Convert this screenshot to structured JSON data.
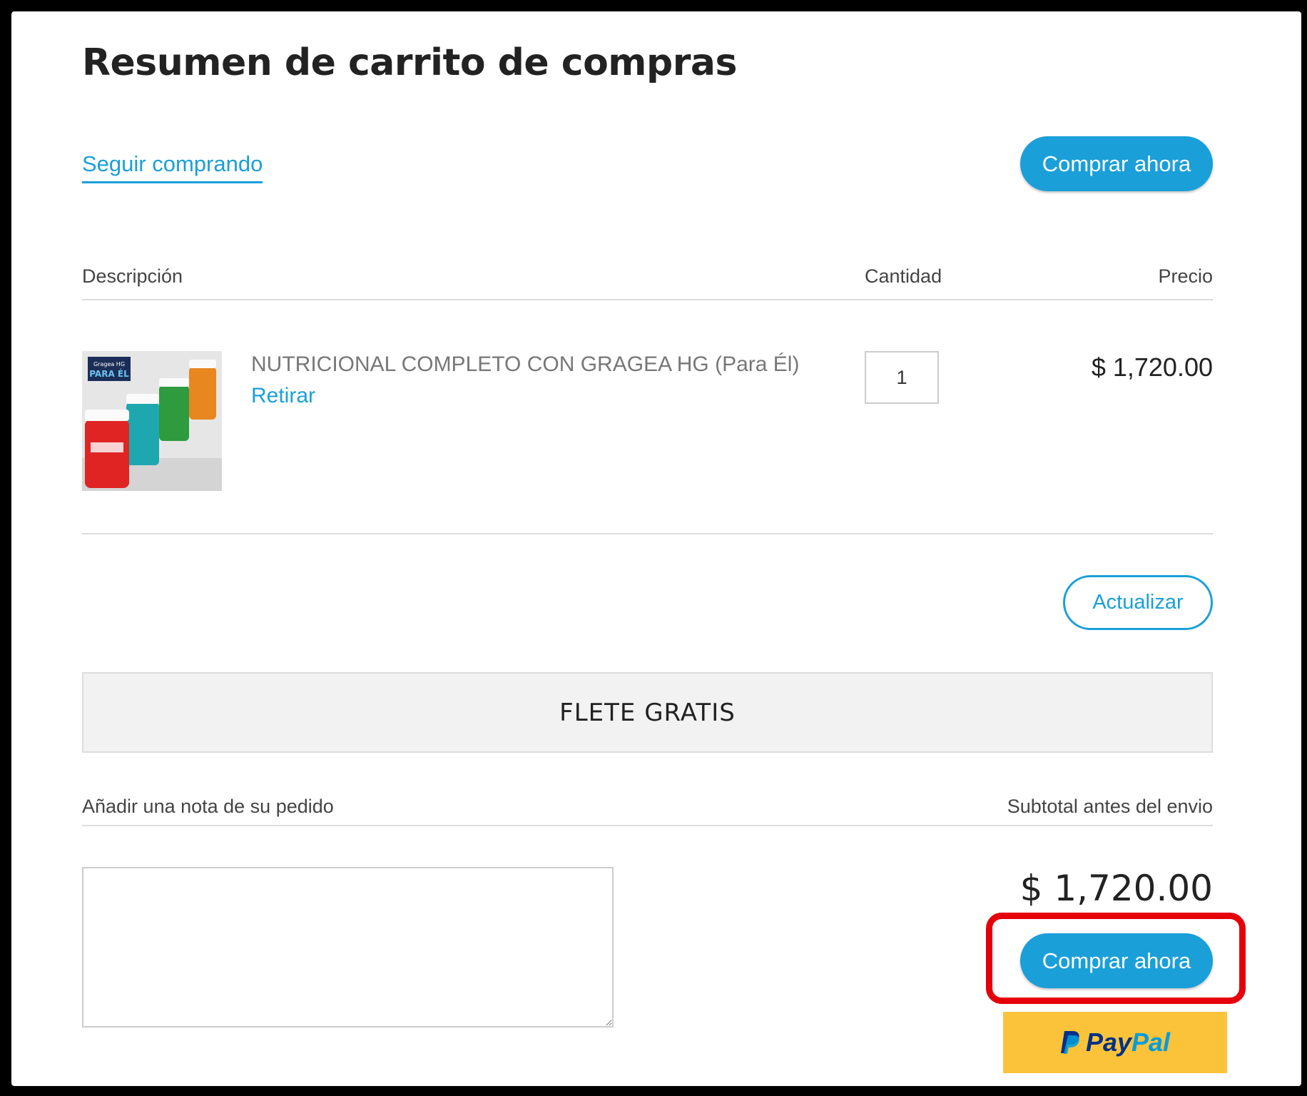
{
  "page": {
    "title": "Resumen de carrito de compras",
    "continue_link": "Seguir comprando",
    "buy_now_label": "Comprar ahora"
  },
  "table": {
    "headers": {
      "description": "Descripción",
      "quantity": "Cantidad",
      "price": "Precio"
    },
    "items": [
      {
        "name": "NUTRICIONAL COMPLETO CON GRAGEA HG (Para Él)",
        "remove_label": "Retirar",
        "quantity": "1",
        "price": "$ 1,720.00",
        "thumbnail_text": [
          "Gragea HG",
          "PARA ÉL"
        ]
      }
    ]
  },
  "update_label": "Actualizar",
  "banner": "FLETE GRATIS",
  "summary": {
    "note_label": "Añadir una nota de su pedido",
    "subtotal_label": "Subtotal antes del envio",
    "subtotal_value": "$ 1,720.00",
    "buy_now_label": "Comprar ahora",
    "paypal": {
      "pay": "Pay",
      "pal": "Pal"
    }
  },
  "colors": {
    "accent": "#1a9fd9",
    "highlight": "#e5000a",
    "paypal_yellow": "#fbc33a"
  }
}
